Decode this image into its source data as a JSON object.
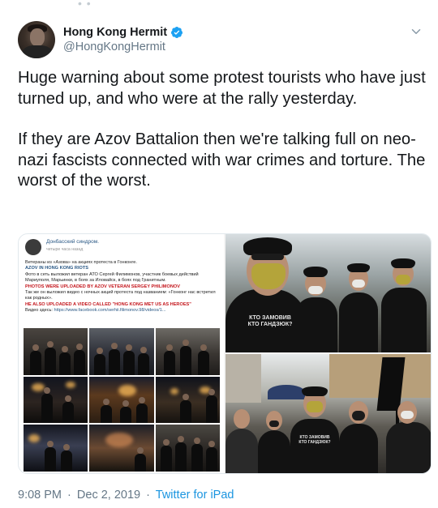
{
  "tweet": {
    "author": {
      "display_name": "Hong Kong Hermit",
      "handle": "@HongKongHermit",
      "verified": true
    },
    "text_paragraphs": [
      "Huge warning about some protest tourists who have just turned up, and who were at the rally yesterday.",
      "If they are Azov Battalion then we're talking full on neo-nazi fascists connected with war crimes and torture. The worst of the worst."
    ],
    "time": "9:08 PM",
    "date": "Dec 2, 2019",
    "separator": "·",
    "source": "Twitter for iPad"
  },
  "media": {
    "embedded_post": {
      "source_name": "Донбасский синдром.",
      "time_ago": "четыре часа назад",
      "line1": "Ветераны из «Азова» на акциях протеста в Гонконге.",
      "headline": "AZOV IN HONG KONG RIOTS",
      "line2": "Фото в сеть выложил ветеран АТО Сергей Филимонов, участник боевых действий Мариуполя, Марьинки, в боях за Иловайск, в боях под Гранитным.",
      "red1": "PHOTOS WERE UPLOADED BY AZOV VETERAN SERGEY PHILIMONOV",
      "line3": "Так же он выложил видео с ночных акций протеста под названием: «Гонконг нас встретил как родных».",
      "red2": "HE ALSO UPLOADED A VIDEO CALLED \"HONG KONG MET US AS HEROES\"",
      "link_label": "Видео здесь:",
      "link": "https://www.facebook.com/serhii.filimonov.98/videos/1..."
    },
    "shirt_text": "КТО ЗАМОВИВ\nКТО ГАНДЗЮК?"
  },
  "colors": {
    "text": "#14171a",
    "muted": "#657786",
    "link": "#1b95e0",
    "verified": "#1da1f2"
  },
  "icons": [
    "verified-badge-icon",
    "chevron-down-icon"
  ]
}
